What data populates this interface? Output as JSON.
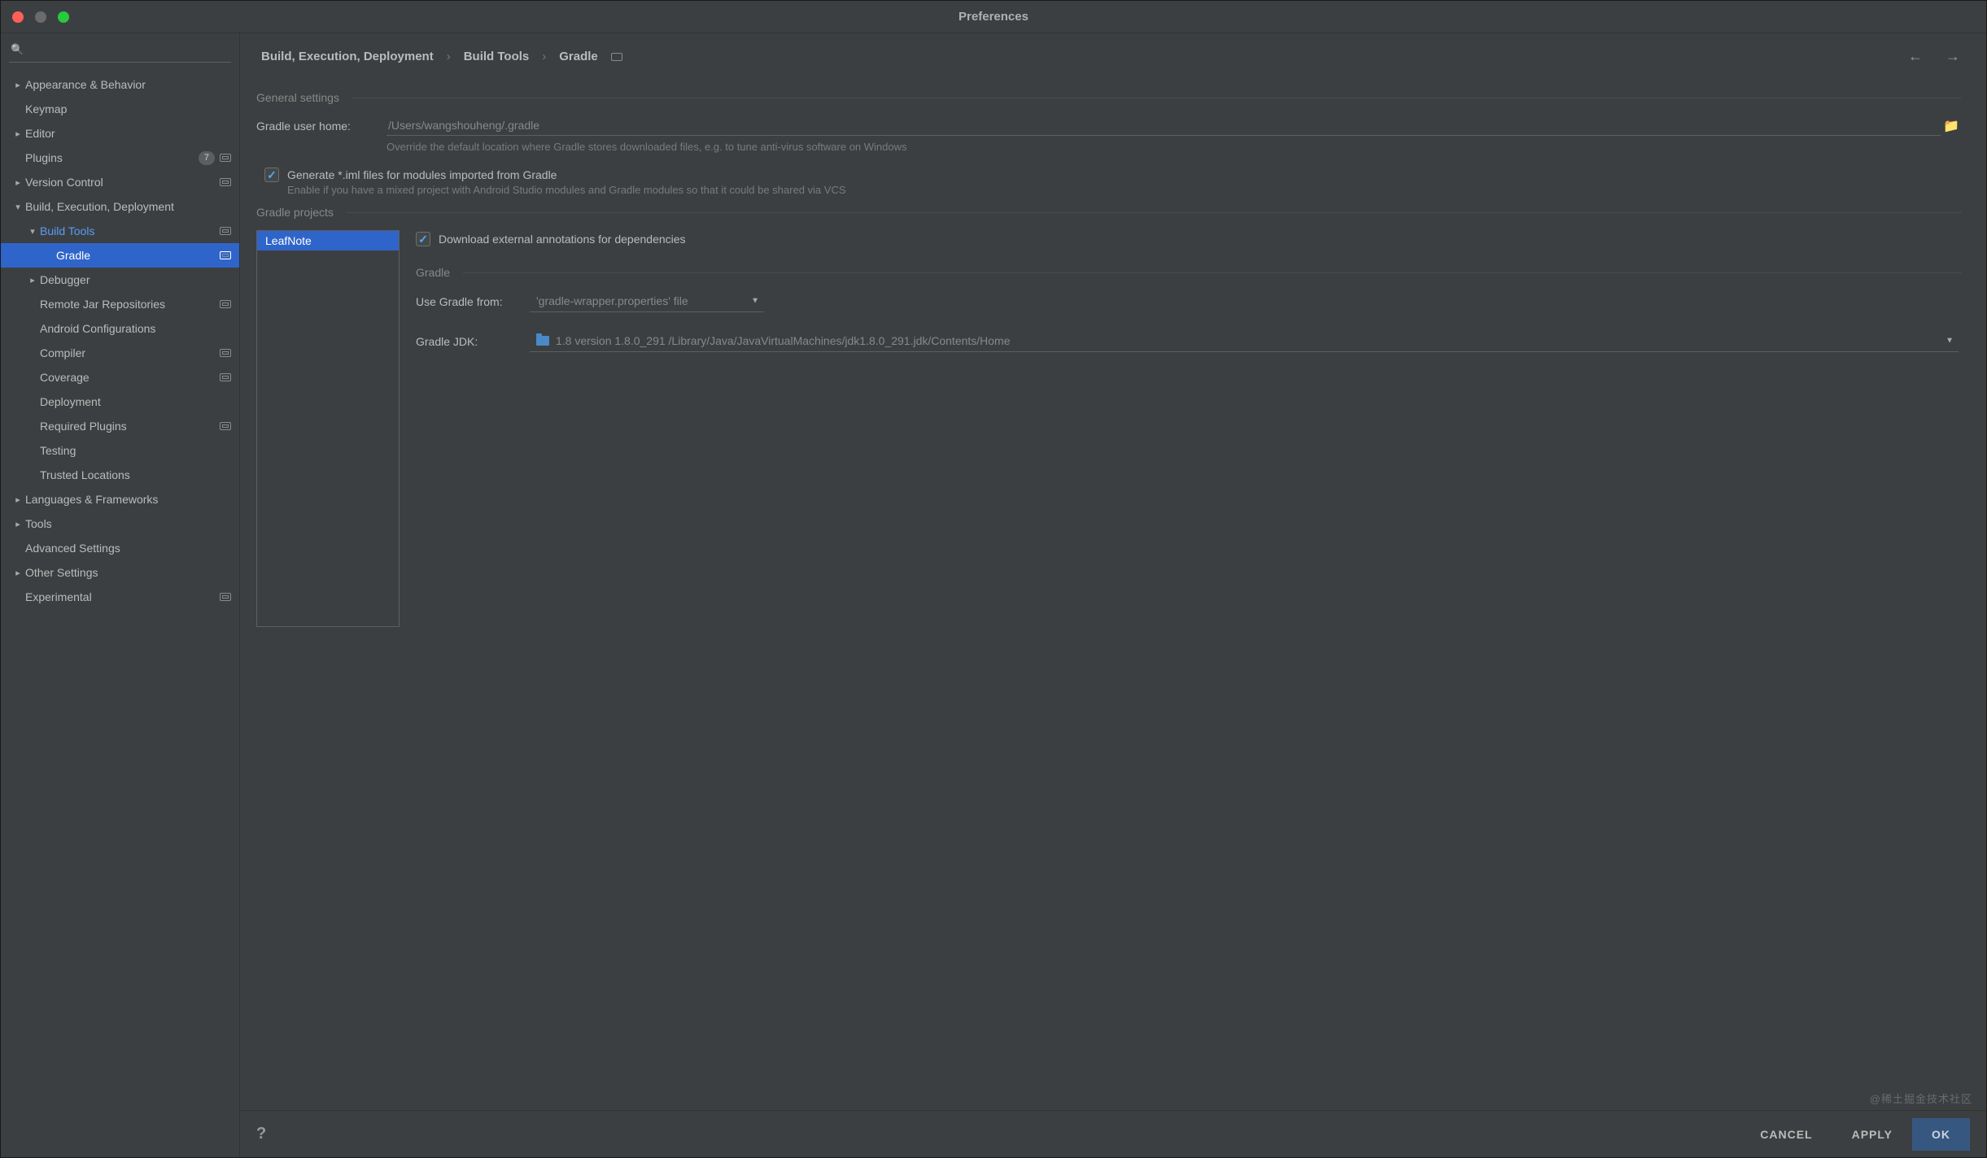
{
  "window": {
    "title": "Preferences"
  },
  "sidebar": {
    "search_placeholder": "",
    "plugins_badge": "7",
    "items": {
      "appearance": "Appearance & Behavior",
      "keymap": "Keymap",
      "editor": "Editor",
      "plugins": "Plugins",
      "version_control": "Version Control",
      "build": "Build, Execution, Deployment",
      "build_tools": "Build Tools",
      "gradle": "Gradle",
      "debugger": "Debugger",
      "remote_jar": "Remote Jar Repositories",
      "android_conf": "Android Configurations",
      "compiler": "Compiler",
      "coverage": "Coverage",
      "deployment": "Deployment",
      "required_plugins": "Required Plugins",
      "testing": "Testing",
      "trusted": "Trusted Locations",
      "languages": "Languages & Frameworks",
      "tools": "Tools",
      "advanced": "Advanced Settings",
      "other": "Other Settings",
      "experimental": "Experimental"
    }
  },
  "breadcrumbs": {
    "seg1": "Build, Execution, Deployment",
    "seg2": "Build Tools",
    "seg3": "Gradle"
  },
  "general": {
    "header": "General settings",
    "user_home_label": "Gradle user home:",
    "user_home_value": "/Users/wangshouheng/.gradle",
    "user_home_hint": "Override the default location where Gradle stores downloaded files, e.g. to tune anti-virus software on Windows",
    "generate_iml_label": "Generate *.iml files for modules imported from Gradle",
    "generate_iml_hint": "Enable if you have a mixed project with Android Studio modules and Gradle modules so that it could be shared via VCS"
  },
  "projects": {
    "header": "Gradle projects",
    "selected": "LeafNote",
    "download_annotations_label": "Download external annotations for dependencies",
    "gradle_header": "Gradle",
    "use_gradle_from_label": "Use Gradle from:",
    "use_gradle_from_value": "'gradle-wrapper.properties' file",
    "gradle_jdk_label": "Gradle JDK:",
    "gradle_jdk_value": "1.8 version 1.8.0_291 /Library/Java/JavaVirtualMachines/jdk1.8.0_291.jdk/Contents/Home"
  },
  "footer": {
    "cancel": "CANCEL",
    "apply": "APPLY",
    "ok": "OK"
  },
  "watermark": "@稀土掘金技术社区"
}
